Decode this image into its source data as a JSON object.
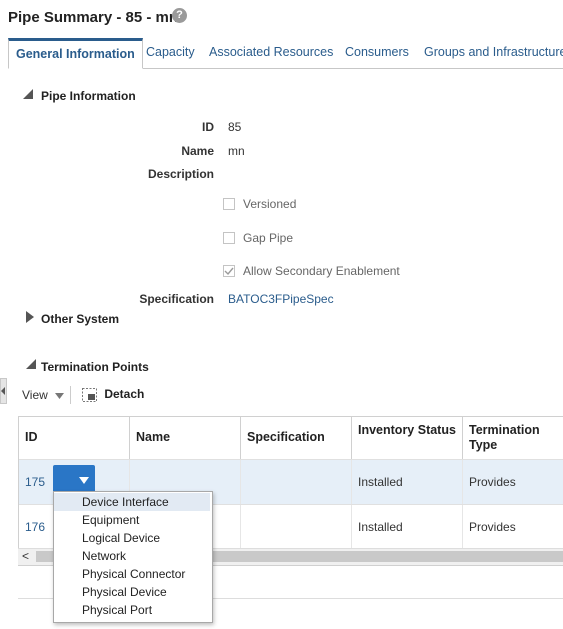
{
  "header": {
    "title": "Pipe Summary - 85 - mn",
    "help_icon": "?"
  },
  "tabs": [
    {
      "label": "General Information",
      "active": true
    },
    {
      "label": "Capacity"
    },
    {
      "label": "Associated Resources"
    },
    {
      "label": "Consumers"
    },
    {
      "label": "Groups and Infrastructure"
    }
  ],
  "pipe_info": {
    "heading": "Pipe Information",
    "id_label": "ID",
    "id_value": "85",
    "name_label": "Name",
    "name_value": "mn",
    "description_label": "Description",
    "versioned": "Versioned",
    "gap_pipe": "Gap Pipe",
    "allow_secondary": "Allow Secondary Enablement",
    "allow_secondary_checked": true,
    "spec_label": "Specification",
    "spec_value": "BATOC3FPipeSpec"
  },
  "other_system": {
    "heading": "Other System"
  },
  "termination": {
    "heading": "Termination Points",
    "view_label": "View",
    "detach_label": "Detach",
    "columns": [
      "ID",
      "Name",
      "Specification",
      "Inventory Status",
      "Termination Type"
    ],
    "rows": [
      {
        "id": "175",
        "name": "",
        "spec": "",
        "status": "Installed",
        "type": "Provides"
      },
      {
        "id": "176",
        "name": "",
        "spec": "",
        "status": "Installed",
        "type": "Provides"
      }
    ],
    "scroll_left": "<"
  },
  "dropdown_menu": {
    "items": [
      "Device Interface",
      "Equipment",
      "Logical Device",
      "Network",
      "Physical Connector",
      "Physical Device",
      "Physical Port"
    ],
    "highlighted_index": 0
  },
  "colors": {
    "accent": "#2a76c6",
    "link": "#2a5c8c",
    "row_selected": "#e6eff8"
  }
}
